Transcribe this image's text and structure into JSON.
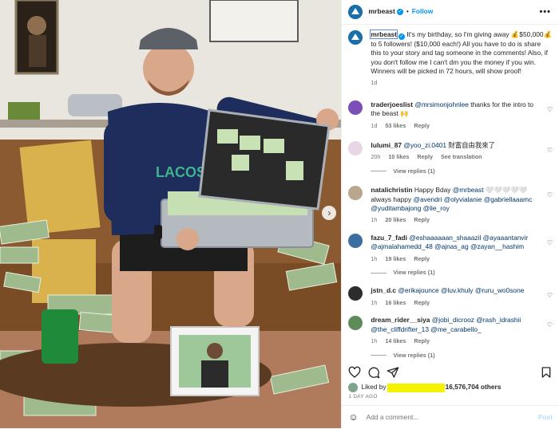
{
  "account": {
    "username": "mrbeast",
    "follow_label": "Follow",
    "separator": "•",
    "more_label": "•••"
  },
  "caption": {
    "username": "mrbeast",
    "text": "It's my birthday, so I'm giving away 💰$50,000💰to 5 followers! ($10,000 each!) All you have to do is share this to your story and tag someone in the comments! Also, if you don't follow me I can't dm you the money if you win. Winners will be picked in 72 hours, will show proof!",
    "time": "1d"
  },
  "comments": [
    {
      "username": "traderjoeslist",
      "mentions": "@mrsimonjohnlee",
      "text": " thanks for the intro to the beast 🙌",
      "time": "1d",
      "likes": "53 likes",
      "reply": "Reply",
      "avatar_color": "#7a4fb6"
    },
    {
      "username": "lulumi_87",
      "mentions": "@yoo_zi.0401",
      "text": " 財富自由我來了",
      "time": "20h",
      "likes": "10 likes",
      "reply": "Reply",
      "translate": "See translation",
      "view_replies": "View replies (1)",
      "avatar_color": "#e8d6e6"
    },
    {
      "username": "natalichristin",
      "text_pre": " Happy Bday ",
      "mentions": "@mrbeast",
      "text": " 🤍🤍🤍🤍🤍 always happy ",
      "mentions2": "@avendri @olyvialanie @gabriellaaamc @yuditambajong @lie_roy",
      "time": "1h",
      "likes": "20 likes",
      "reply": "Reply",
      "avatar_color": "#b9a68f"
    },
    {
      "username": "fazu_7_fadi",
      "mentions": "@eshaaaaaan_shaaazil @ayaaantanvir @ajmalahamedd_48 @ajnas_ag @zayan__hashim",
      "time": "1h",
      "likes": "19 likes",
      "reply": "Reply",
      "view_replies": "View replies (1)",
      "avatar_color": "#3b6fa0"
    },
    {
      "username": "jstn_d.c",
      "mentions": "@erikajounce @luv.khuly @ruru_wo0sone",
      "time": "1h",
      "likes": "16 likes",
      "reply": "Reply",
      "avatar_color": "#2c2c2c"
    },
    {
      "username": "dream_rider__siya",
      "mentions": "@jobi_dicrooz @rash_idrashii @the_cliffdrifter_13 @me_carabello_",
      "time": "1h",
      "likes": "14 likes",
      "reply": "Reply",
      "view_replies": "View replies (1)",
      "avatar_color": "#5f8a5a"
    }
  ],
  "footer": {
    "liked_by": "Liked by",
    "others": "16,576,704 others",
    "ago": "1 DAY AGO",
    "add_comment_placeholder": "Add a comment...",
    "post_label": "Post"
  },
  "colors": {
    "accent": "#0095f6",
    "mention": "#00376b",
    "muted": "#737373",
    "redaction": "#f5f200"
  }
}
